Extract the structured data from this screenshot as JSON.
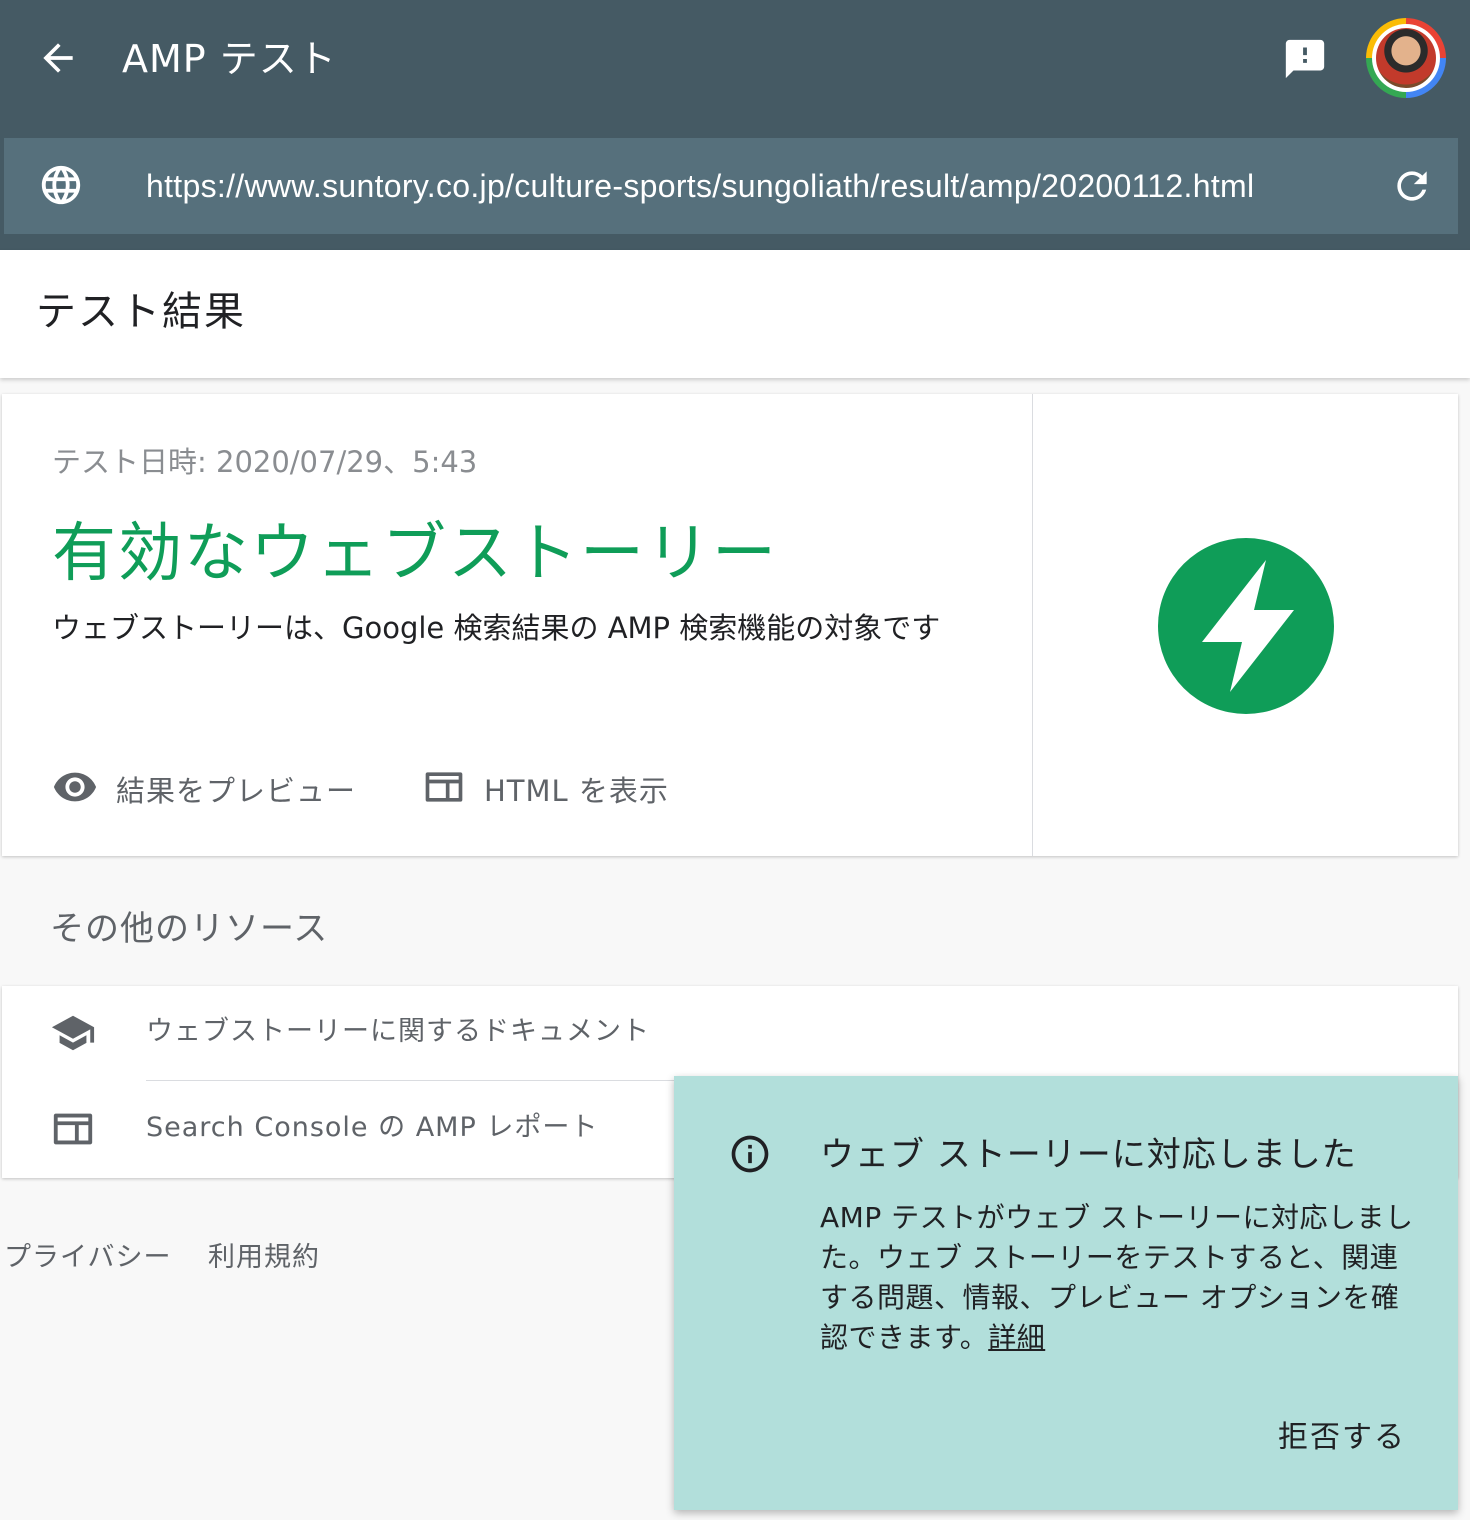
{
  "header": {
    "title": "AMP テスト",
    "url": "https://www.suntory.co.jp/culture-sports/sungoliath/result/amp/20200112.html"
  },
  "page_title": "テスト結果",
  "result": {
    "test_date": "テスト日時: 2020/07/29、5:43",
    "status_title": "有効なウェブストーリー",
    "status_description": "ウェブストーリーは、Google 検索結果の AMP 検索機能の対象です",
    "actions": [
      {
        "label": "結果をプレビュー",
        "icon": "eye-icon"
      },
      {
        "label": "HTML を表示",
        "icon": "html-view-icon"
      }
    ],
    "logo_color": "#0f9d58"
  },
  "resources": {
    "title": "その他のリソース",
    "items": [
      {
        "label": "ウェブストーリーに関するドキュメント",
        "icon": "school-icon"
      },
      {
        "label": "Search Console の AMP レポート",
        "icon": "web-panel-icon"
      }
    ]
  },
  "footer": {
    "links": [
      "プライバシー",
      "利用規約"
    ]
  },
  "snackbar": {
    "title": "ウェブ ストーリーに対応しました",
    "body": "AMP テストがウェブ ストーリーに対応しました。ウェブ ストーリーをテストすると、関連する問題、情報、プレビュー オプションを確認できます。",
    "link": "詳細",
    "dismiss": "拒否する"
  },
  "colors": {
    "header_bg": "#455a64",
    "urlbar_bg": "#56707c",
    "success_green": "#0f9d58",
    "snackbar_bg": "#b2dfdb"
  }
}
